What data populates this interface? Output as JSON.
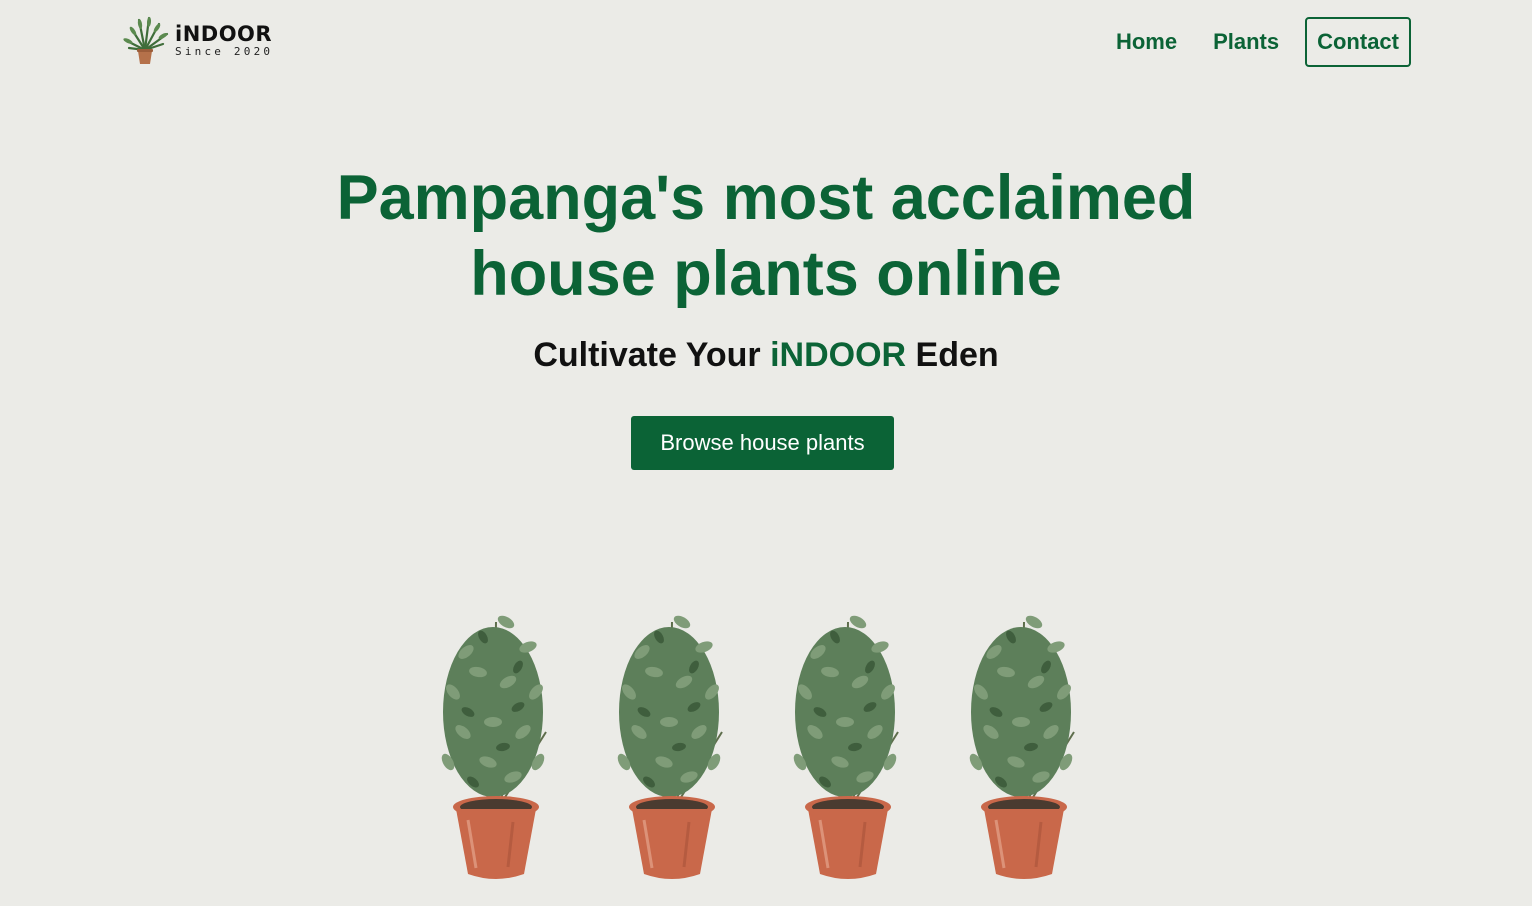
{
  "header": {
    "logo": {
      "name": "iNDOOR",
      "since": "Since 2020"
    },
    "nav": [
      {
        "label": "Home"
      },
      {
        "label": "Plants"
      },
      {
        "label": "Contact"
      }
    ]
  },
  "hero": {
    "title_line1": "Pampanga's most acclaimed",
    "title_line2": "house plants online",
    "tagline_prefix": "Cultivate Your ",
    "tagline_brand": "iNDOOR",
    "tagline_suffix": " Eden",
    "cta_label": "Browse house plants"
  },
  "colors": {
    "brand_green": "#0b6336",
    "background": "#ebebe7",
    "pot": "#c9684a"
  },
  "plants": [
    {
      "icon": "potted-plant-image"
    },
    {
      "icon": "potted-plant-image"
    },
    {
      "icon": "potted-plant-image"
    },
    {
      "icon": "potted-plant-image"
    }
  ]
}
